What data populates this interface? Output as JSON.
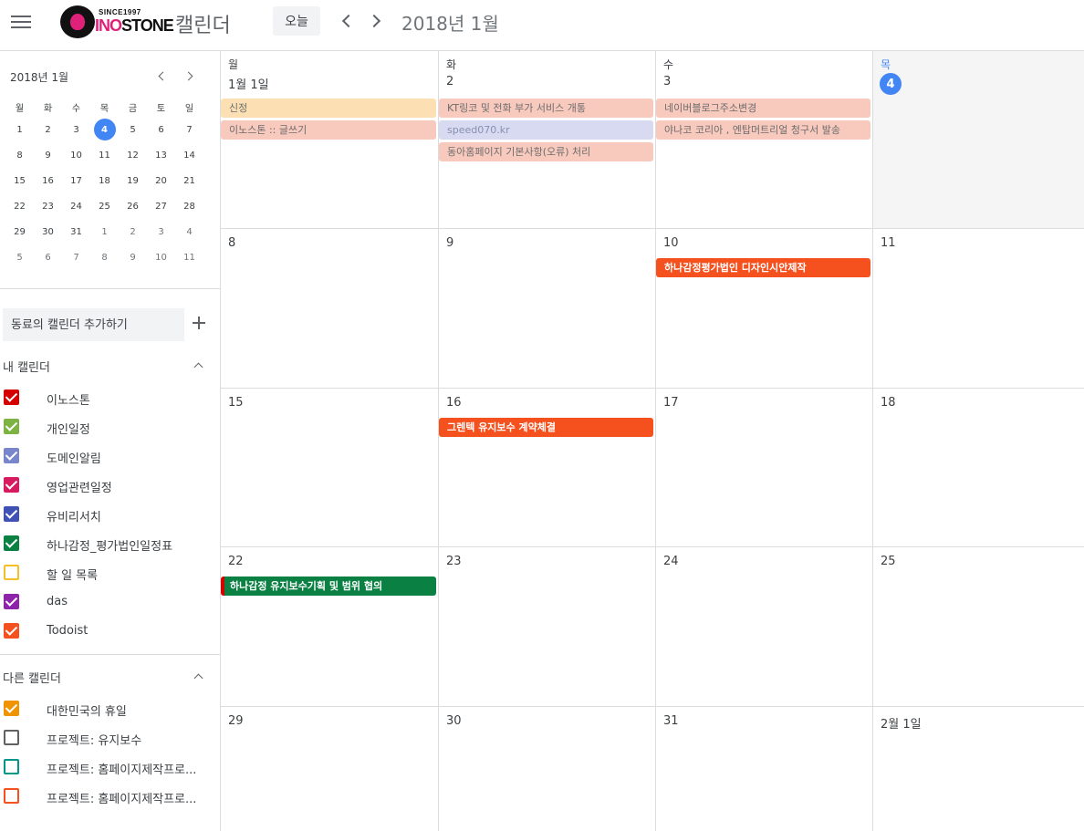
{
  "header": {
    "logo_since": "SINCE1997",
    "logo_brand_a": "INO",
    "logo_brand_b": "STONE",
    "app_title": "캘린더",
    "today_label": "오늘",
    "current_month": "2018년 1월"
  },
  "mini_calendar": {
    "title": "2018년 1월",
    "dow": [
      "월",
      "화",
      "수",
      "목",
      "금",
      "토",
      "일"
    ],
    "weeks": [
      [
        "1",
        "2",
        "3",
        "4",
        "5",
        "6",
        "7"
      ],
      [
        "8",
        "9",
        "10",
        "11",
        "12",
        "13",
        "14"
      ],
      [
        "15",
        "16",
        "17",
        "18",
        "19",
        "20",
        "21"
      ],
      [
        "22",
        "23",
        "24",
        "25",
        "26",
        "27",
        "28"
      ],
      [
        "29",
        "30",
        "31",
        "1",
        "2",
        "3",
        "4"
      ],
      [
        "5",
        "6",
        "7",
        "8",
        "9",
        "10",
        "11"
      ]
    ]
  },
  "sidebar": {
    "add_calendar_placeholder": "동료의 캘린더 추가하기",
    "my_calendars_title": "내 캘린더",
    "my_calendars": [
      {
        "label": "이노스톤",
        "color": "#d50000",
        "checked": true
      },
      {
        "label": "개인일정",
        "color": "#7cb342",
        "checked": true
      },
      {
        "label": "도메인알림",
        "color": "#7986cb",
        "checked": true
      },
      {
        "label": "영업관련일정",
        "color": "#d81b60",
        "checked": true
      },
      {
        "label": "유비리서치",
        "color": "#3f51b5",
        "checked": true
      },
      {
        "label": "하나감정_평가법인일정표",
        "color": "#0b8043",
        "checked": true
      },
      {
        "label": "할 일 목록",
        "color": "#f6bf26",
        "checked": false
      },
      {
        "label": "das",
        "color": "#8e24aa",
        "checked": true
      },
      {
        "label": "Todoist",
        "color": "#f4511e",
        "checked": true
      }
    ],
    "other_calendars_title": "다른 캘린더",
    "other_calendars": [
      {
        "label": "대한민국의 휴일",
        "color": "#f09300",
        "checked": true
      },
      {
        "label": "프로젝트: 유지보수",
        "color": "#616161",
        "checked": false
      },
      {
        "label": "프로젝트: 홈페이지제작프로...",
        "color": "#009688",
        "checked": false
      },
      {
        "label": "프로젝트: 홈페이지제작프로...",
        "color": "#f4511e",
        "checked": false
      }
    ]
  },
  "month": {
    "dow": [
      "월",
      "화",
      "수",
      "목"
    ],
    "week1_dates": [
      "1월 1일",
      "2",
      "3",
      "4"
    ],
    "weeks_dates": [
      [
        "8",
        "9",
        "10",
        "11"
      ],
      [
        "15",
        "16",
        "17",
        "18"
      ],
      [
        "22",
        "23",
        "24",
        "25"
      ],
      [
        "29",
        "30",
        "31",
        "2월 1일"
      ]
    ],
    "events": {
      "mon1_a": "신정",
      "mon1_b": "이노스톤 :: 글쓰기",
      "tue2_a": "KT링코 및 전화 부가 서비스 개통",
      "tue2_b": "speed070.kr",
      "tue2_c": "동아홈페이지 기본사항(오류) 처리",
      "wed3_a": "네이버블로그주소변경",
      "wed3_b": "야나코 코리아 , 엔탑머트리얼 청구서 발송",
      "wed10": "하나감정평가법인 디자인시안제작",
      "tue16": "그렌텍 유지보수 계약체결",
      "mon22": "하나감정 유지보수기획 및 범위 협의"
    },
    "event_colors": {
      "holiday_past": "#fce0b3",
      "red_past": "#f8c9bd",
      "blue_past": "#d7daf0",
      "orange": "#f4511e",
      "green": "#0b8043",
      "red_border": "#d50000"
    }
  }
}
